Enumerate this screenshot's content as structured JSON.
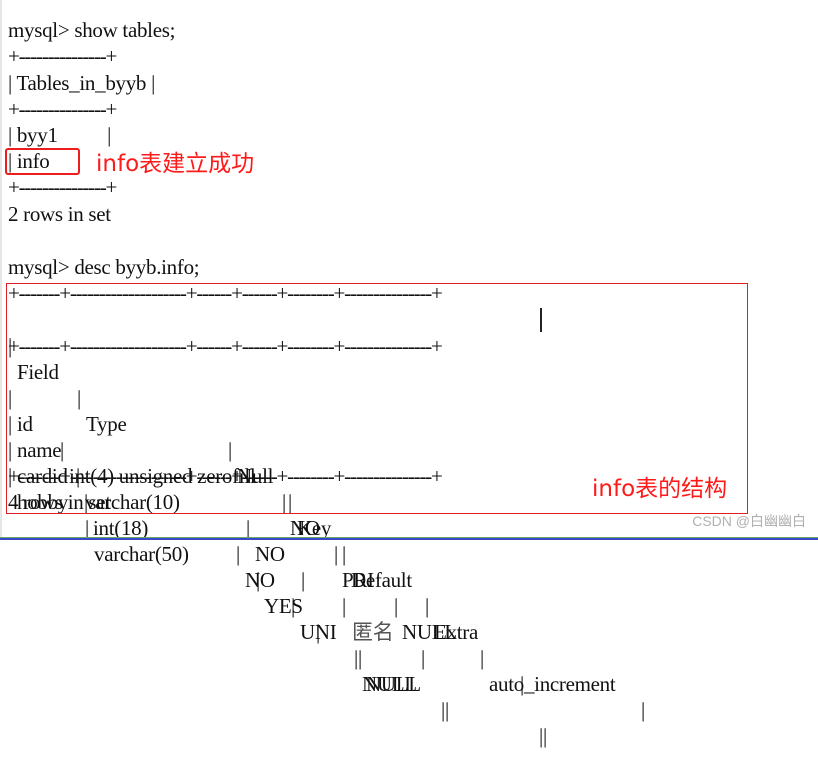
{
  "terminal": {
    "show_tables": {
      "prompt": "mysql> show tables;",
      "border": "+---------------+",
      "header": "| Tables_in_byyb |",
      "rows": [
        "| byy1          |",
        "| info"
      ],
      "footer": "2 rows in set"
    },
    "desc": {
      "prompt": "mysql> desc byyb.info;",
      "border": "+-------+--------------------+------+------+--------+---------------+",
      "columns": [
        "Field",
        "Type",
        "Null",
        "Key",
        "Default",
        "Extra"
      ],
      "rows": [
        [
          "id",
          "int(4) unsigned zerofill",
          "NO",
          "PRI",
          "NULL",
          "auto_increment"
        ],
        [
          "name",
          "varchar(10)",
          "NO",
          "",
          "匿名",
          ""
        ],
        [
          "cardid",
          "int(18)",
          "NO",
          "UNI",
          "NULL",
          ""
        ],
        [
          "hobby",
          "varchar(50)",
          "YES",
          "",
          "NULL",
          ""
        ]
      ],
      "footer": "4 rows in set"
    }
  },
  "annotations": {
    "info_created": "info表建立成功",
    "info_structure": "info表的结构"
  },
  "watermark": "CSDN @白幽幽白",
  "colors": {
    "annotation": "#ff1a1a",
    "terminal_text": "#111111"
  }
}
